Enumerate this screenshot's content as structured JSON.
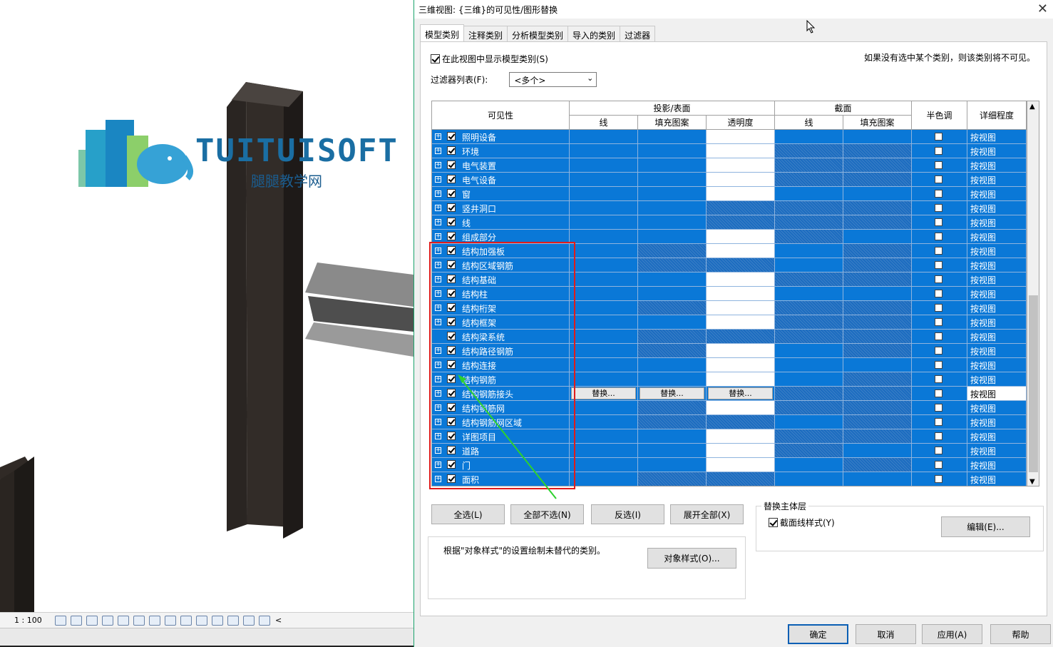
{
  "viewport": {
    "logo_text": "TUITUISOFT",
    "logo_subtext": "腿腿教学网",
    "scale": "1 : 100"
  },
  "dialog": {
    "title": "三维视图: {三维}的可见性/图形替换",
    "close": "✕",
    "tabs": [
      "模型类别",
      "注释类别",
      "分析模型类别",
      "导入的类别",
      "过滤器"
    ],
    "show_models_label": "在此视图中显示模型类别(S)",
    "hint": "如果没有选中某个类别，则该类别将不可见。",
    "filter_label": "过滤器列表(F):",
    "filter_value": "<多个>",
    "headers": {
      "visibility": "可见性",
      "projection": "投影/表面",
      "line": "线",
      "fill": "填充图案",
      "transparency": "透明度",
      "section": "截面",
      "section_line": "线",
      "section_fill": "填充图案",
      "halftone": "半色调",
      "detail": "详细程度"
    },
    "override_label": "替换...",
    "rows": [
      {
        "name": "照明设备",
        "detail": "按视图",
        "checked": true
      },
      {
        "name": "环境",
        "detail": "按视图",
        "checked": true
      },
      {
        "name": "电气装置",
        "detail": "按视图",
        "checked": true
      },
      {
        "name": "电气设备",
        "detail": "按视图",
        "checked": true
      },
      {
        "name": "窗",
        "detail": "按视图",
        "checked": true
      },
      {
        "name": "竖井洞口",
        "detail": "按视图",
        "checked": true
      },
      {
        "name": "线",
        "detail": "按视图",
        "checked": true
      },
      {
        "name": "组成部分",
        "detail": "按视图",
        "checked": true
      },
      {
        "name": "结构加强板",
        "detail": "按视图",
        "checked": true
      },
      {
        "name": "结构区域钢筋",
        "detail": "按视图",
        "checked": true
      },
      {
        "name": "结构基础",
        "detail": "按视图",
        "checked": true
      },
      {
        "name": "结构柱",
        "detail": "按视图",
        "checked": true
      },
      {
        "name": "结构桁架",
        "detail": "按视图",
        "checked": true
      },
      {
        "name": "结构框架",
        "detail": "按视图",
        "checked": true
      },
      {
        "name": "结构梁系统",
        "detail": "按视图",
        "checked": true
      },
      {
        "name": "结构路径钢筋",
        "detail": "按视图",
        "checked": true
      },
      {
        "name": "结构连接",
        "detail": "按视图",
        "checked": true
      },
      {
        "name": "结构钢筋",
        "detail": "按视图",
        "checked": true
      },
      {
        "name": "结构钢筋接头",
        "detail": "按视图",
        "checked": true
      },
      {
        "name": "结构钢筋网",
        "detail": "按视图",
        "checked": true
      },
      {
        "name": "结构钢筋网区域",
        "detail": "按视图",
        "checked": true
      },
      {
        "name": "详图项目",
        "detail": "按视图",
        "checked": true
      },
      {
        "name": "道路",
        "detail": "按视图",
        "checked": true
      },
      {
        "name": "门",
        "detail": "按视图",
        "checked": true
      },
      {
        "name": "面积",
        "detail": "按视图",
        "checked": true
      }
    ],
    "buttons": {
      "select_all": "全选(L)",
      "select_none": "全部不选(N)",
      "invert": "反选(I)",
      "expand_all": "展开全部(X)",
      "object_styles": "对象样式(O)...",
      "edit": "编辑(E)...",
      "ok": "确定",
      "cancel": "取消",
      "apply": "应用(A)",
      "help": "帮助"
    },
    "host_layer_title": "替换主体层",
    "section_line_style": "截面线样式(Y)",
    "info_text": "根据\"对象样式\"的设置绘制未替代的类别。"
  }
}
